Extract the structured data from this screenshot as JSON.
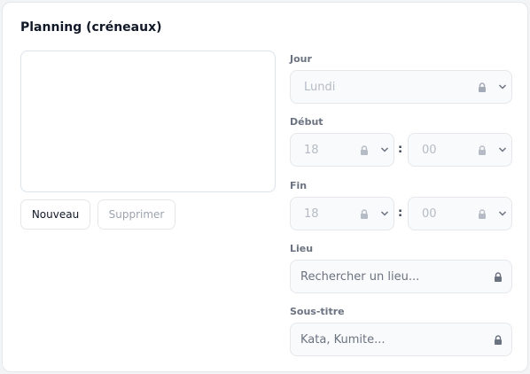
{
  "panel": {
    "title": "Planning (créneaux)"
  },
  "buttons": {
    "new_label": "Nouveau",
    "delete_label": "Supprimer"
  },
  "form": {
    "day": {
      "label": "Jour",
      "value": "Lundi"
    },
    "start": {
      "label": "Début",
      "hour": "18",
      "minute": "00",
      "separator": ":"
    },
    "end": {
      "label": "Fin",
      "hour": "18",
      "minute": "00",
      "separator": ":"
    },
    "place": {
      "label": "Lieu",
      "placeholder": "Rechercher un lieu..."
    },
    "subtitle": {
      "label": "Sous-titre",
      "placeholder": "Kata, Kumite..."
    }
  },
  "icons": {
    "lock": "lock-icon",
    "chevron": "chevron-down-icon"
  },
  "colors": {
    "border": "#e5e7eb",
    "disabled_bg": "#f9fafb",
    "disabled_text": "#b5bcc6",
    "label": "#6b7280"
  }
}
